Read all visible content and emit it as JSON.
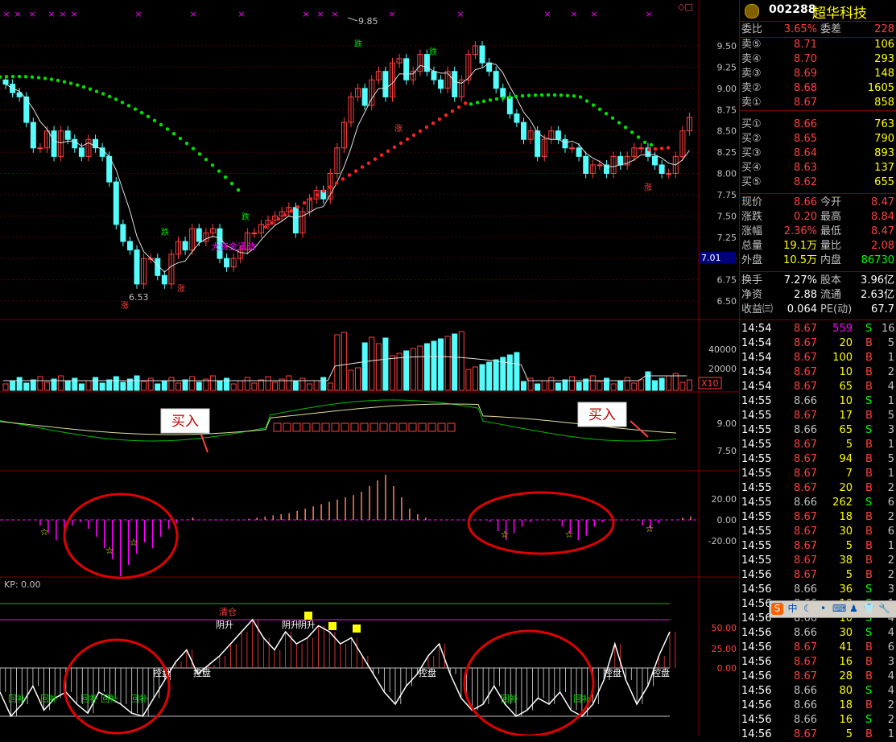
{
  "colors": {
    "up": "#ff4040",
    "down": "#54fcfc",
    "green": "#00e000",
    "magenta": "#ff00ff",
    "yellow": "#ffff00",
    "white": "#ffffff",
    "grid": "#800000",
    "label": "#c0c0c0"
  },
  "main_panel": {
    "price_ticks": [
      "9.50",
      "9.25",
      "9.00",
      "8.75",
      "8.50",
      "8.25",
      "8.00",
      "7.75",
      "7.50",
      "7.25",
      "7.00",
      "6.75",
      "6.50"
    ],
    "current_price_marker": "7.01",
    "high_label": "9.85",
    "low_label": "6.53",
    "annotation": "大资金涌动",
    "up_mark": "涨",
    "down_mark": "跌",
    "cross_mark": "×",
    "corner_icons": "◇□"
  },
  "volume_panel": {
    "ticks": [
      "40000",
      "20000"
    ],
    "unit": "X10"
  },
  "buy_panel": {
    "ticks": [
      "9.00",
      "7.50"
    ],
    "buy_label": "买入"
  },
  "osc_panel": {
    "ticks": [
      "20.00",
      "0.00",
      "-20.00"
    ],
    "star": "☆"
  },
  "kp_panel": {
    "title": "KP: 0.00",
    "ticks": [
      "50.00",
      "25.00",
      "0.00"
    ],
    "labels": {
      "hold": "控盘",
      "fill": "回补",
      "rise": "阴升",
      "clear": "清仓"
    }
  },
  "quote": {
    "code": "002288",
    "name": "超华科技",
    "weibi_label": "委比",
    "weibi_value": "3.65%",
    "weicha_label": "委差",
    "weicha_value": "228",
    "asks": [
      [
        "卖⑤",
        "8.71",
        "106"
      ],
      [
        "卖④",
        "8.70",
        "293"
      ],
      [
        "卖③",
        "8.69",
        "148"
      ],
      [
        "卖②",
        "8.68",
        "1605"
      ],
      [
        "卖①",
        "8.67",
        "858"
      ]
    ],
    "bids": [
      [
        "买①",
        "8.66",
        "763"
      ],
      [
        "买②",
        "8.65",
        "790"
      ],
      [
        "买③",
        "8.64",
        "893"
      ],
      [
        "买④",
        "8.63",
        "137"
      ],
      [
        "买⑤",
        "8.62",
        "655"
      ]
    ],
    "stats": [
      [
        "现价",
        "8.66",
        "今开",
        "8.47"
      ],
      [
        "涨跌",
        "0.20",
        "最高",
        "8.84"
      ],
      [
        "涨幅",
        "2.36%",
        "最低",
        "8.47"
      ],
      [
        "总量",
        "19.1万",
        "量比",
        "2.08"
      ],
      [
        "外盘",
        "10.5万",
        "内盘",
        "86730"
      ]
    ],
    "stats2": [
      [
        "换手",
        "7.27%",
        "股本",
        "3.96亿"
      ],
      [
        "净资",
        "2.88",
        "流通",
        "2.63亿"
      ],
      [
        "收益㈢",
        "0.064",
        "PE(动)",
        "67.7"
      ]
    ],
    "ticks": [
      [
        "14:54",
        "8.67",
        "559",
        "S",
        "16"
      ],
      [
        "14:54",
        "8.67",
        "20",
        "B",
        "5"
      ],
      [
        "14:54",
        "8.67",
        "100",
        "B",
        "1"
      ],
      [
        "14:54",
        "8.67",
        "10",
        "B",
        "2"
      ],
      [
        "14:54",
        "8.67",
        "65",
        "B",
        "4"
      ],
      [
        "14:55",
        "8.66",
        "10",
        "S",
        "1"
      ],
      [
        "14:55",
        "8.67",
        "17",
        "B",
        "5"
      ],
      [
        "14:55",
        "8.66",
        "65",
        "S",
        "3"
      ],
      [
        "14:55",
        "8.67",
        "5",
        "B",
        "1"
      ],
      [
        "14:55",
        "8.67",
        "94",
        "B",
        "5"
      ],
      [
        "14:55",
        "8.67",
        "7",
        "B",
        "1"
      ],
      [
        "14:55",
        "8.67",
        "20",
        "B",
        "2"
      ],
      [
        "14:55",
        "8.66",
        "262",
        "S",
        "6"
      ],
      [
        "14:55",
        "8.67",
        "18",
        "B",
        "2"
      ],
      [
        "14:55",
        "8.67",
        "30",
        "B",
        "6"
      ],
      [
        "14:55",
        "8.67",
        "5",
        "B",
        "1"
      ],
      [
        "14:55",
        "8.67",
        "38",
        "B",
        "2"
      ],
      [
        "14:56",
        "8.67",
        "5",
        "B",
        "2"
      ],
      [
        "14:56",
        "8.66",
        "36",
        "S",
        "3"
      ],
      [
        "14:56",
        "8.66",
        "10",
        "S",
        "1"
      ],
      [
        "14:56",
        "8.66",
        "10",
        "S",
        "4"
      ],
      [
        "14:56",
        "8.66",
        "30",
        "S",
        "4"
      ],
      [
        "14:56",
        "8.67",
        "41",
        "B",
        "6"
      ],
      [
        "14:56",
        "8.67",
        "16",
        "B",
        "3"
      ],
      [
        "14:56",
        "8.67",
        "28",
        "B",
        "4"
      ],
      [
        "14:56",
        "8.66",
        "80",
        "S",
        "4"
      ],
      [
        "14:56",
        "8.66",
        "18",
        "B",
        "2"
      ],
      [
        "14:56",
        "8.66",
        "16",
        "S",
        "2"
      ],
      [
        "14:56",
        "8.67",
        "5",
        "B",
        "1"
      ]
    ],
    "toolbar_icons": [
      "sogou-icon",
      "zh-icon",
      "moon-icon",
      "dot-icon",
      "keyboard-icon",
      "user-icon",
      "shirt-icon",
      "wrench-icon"
    ],
    "toolbar_glyphs": [
      "S",
      "中",
      "☾",
      "•",
      "⌨",
      "♟",
      "👕",
      "🔧"
    ]
  }
}
